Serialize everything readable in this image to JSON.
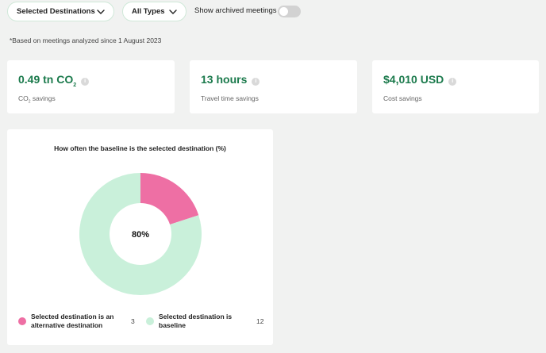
{
  "filters": {
    "destination_label": "Selected Destinations",
    "type_label": "All Types",
    "archived_label": "Show archived meetings",
    "archived_on": false
  },
  "note": "*Based on meetings analyzed since 1 August 2023",
  "cards": [
    {
      "value": "0.49 tn CO",
      "sub": "2",
      "label": "CO",
      "label_sub": "2",
      "label_rest": " savings"
    },
    {
      "value": "13 hours",
      "label": "Travel time savings"
    },
    {
      "value": "$4,010 USD",
      "label": "Cost savings"
    }
  ],
  "chart": {
    "title": "How often the baseline is the selected destination (%)",
    "center_label": "80%",
    "legend": [
      {
        "label": "Selected destination is an alternative destination",
        "count": "3",
        "color": "#ee6fa4"
      },
      {
        "label": "Selected destination is baseline",
        "count": "12",
        "color": "#c9f0da"
      }
    ]
  },
  "chart_data": {
    "type": "pie",
    "title": "How often the baseline is the selected destination (%)",
    "categories": [
      "Selected destination is an alternative destination",
      "Selected destination is baseline"
    ],
    "values": [
      3,
      12
    ],
    "colors": [
      "#ee6fa4",
      "#c9f0da"
    ]
  },
  "colors": {
    "accent": "#1b7a4c",
    "pink": "#ee6fa4",
    "mint": "#c9f0da"
  }
}
